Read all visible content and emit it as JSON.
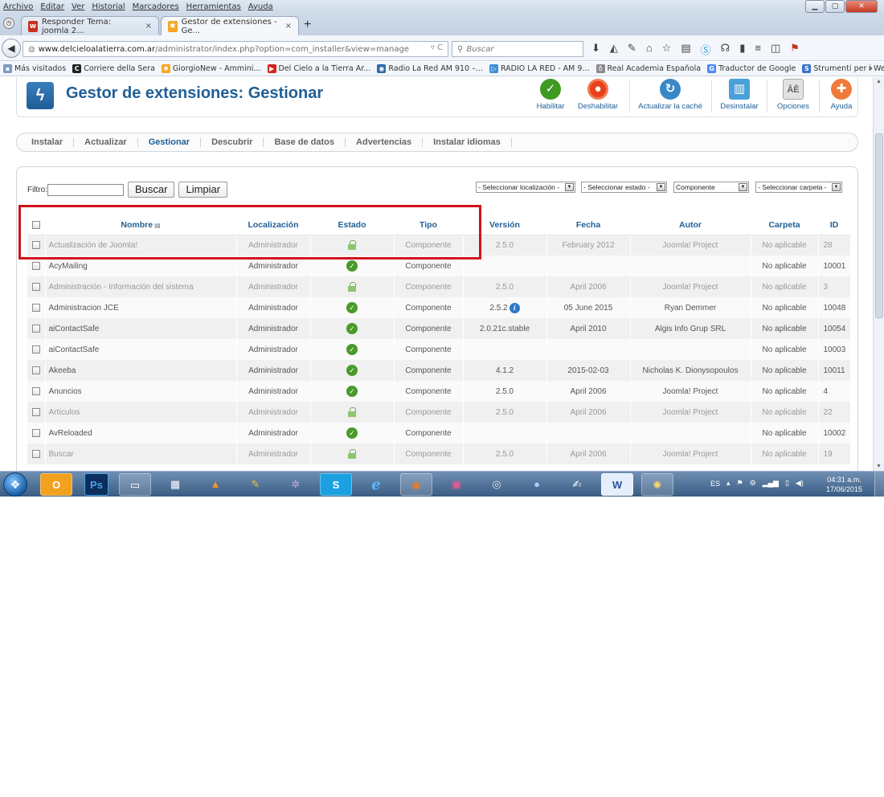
{
  "menubar": {
    "items": [
      "Archivo",
      "Editar",
      "Ver",
      "Historial",
      "Marcadores",
      "Herramientas",
      "Ayuda"
    ]
  },
  "tabs": [
    {
      "title": "Responder Tema: joomla 2...",
      "active": false
    },
    {
      "title": "Gestor de extensiones - Ge...",
      "active": true
    }
  ],
  "tab_new_label": "+",
  "navigation": {
    "url_domain": "www.delcieloalatierra.com.ar",
    "url_path": "/administrator/index.php?option=com_installer&view=manage",
    "search_placeholder": "Buscar"
  },
  "bookmarks": [
    "Más visitados",
    "Corriere della Sera",
    "GiorgioNew - Ammini...",
    "Del Cielo a la Tierra Ar...",
    "Radio La Red AM 910 –...",
    "RADIO LA RED - AM 9...",
    "Real Academia Española",
    "Traductor de Google",
    "Strumenti per i Webm..."
  ],
  "bookmarks_overflow": "»",
  "page": {
    "title": "Gestor de extensiones: Gestionar",
    "toolbar": {
      "enable": "Habilitar",
      "disable": "Deshabilitar",
      "refresh_cache": "Actualizar la caché",
      "uninstall": "Desinstalar",
      "options": "Opciones",
      "help": "Ayuda"
    },
    "subnav": [
      {
        "label": "Instalar",
        "active": false
      },
      {
        "label": "Actualizar",
        "active": false
      },
      {
        "label": "Gestionar",
        "active": true
      },
      {
        "label": "Descubrir",
        "active": false
      },
      {
        "label": "Base de datos",
        "active": false
      },
      {
        "label": "Advertencias",
        "active": false
      },
      {
        "label": "Instalar idiomas",
        "active": false
      }
    ],
    "filter": {
      "label": "Filtro:",
      "value": "",
      "search_button": "Buscar",
      "clear_button": "Limpiar",
      "location_select": "- Seleccionar localización -",
      "state_select": "- Seleccionar estado -",
      "type_select": "Componente",
      "folder_select": "- Seleccionar carpeta -"
    },
    "table": {
      "columns": [
        "Nombre",
        "Localización",
        "Estado",
        "Tipo",
        "Versión",
        "Fecha",
        "Autor",
        "Carpeta",
        "ID"
      ],
      "rows": [
        {
          "name": "Actualización de Joomla!",
          "location": "Administrador",
          "state": "locked",
          "type": "Componente",
          "version": "2.5.0",
          "date": "February 2012",
          "author": "Joomla! Project",
          "folder": "No aplicable",
          "id": "28",
          "disabled": true,
          "info": false
        },
        {
          "name": "AcyMailing",
          "location": "Administrador",
          "state": "enabled",
          "type": "Componente",
          "version": "",
          "date": "",
          "author": "",
          "folder": "No aplicable",
          "id": "10001",
          "disabled": false,
          "info": false
        },
        {
          "name": "Administración - Información del sistema",
          "location": "Administrador",
          "state": "locked",
          "type": "Componente",
          "version": "2.5.0",
          "date": "April 2006",
          "author": "Joomla! Project",
          "folder": "No aplicable",
          "id": "3",
          "disabled": true,
          "info": false
        },
        {
          "name": "Administracion JCE",
          "location": "Administrador",
          "state": "enabled",
          "type": "Componente",
          "version": "2.5.2",
          "date": "05 June 2015",
          "author": "Ryan Demmer",
          "folder": "No aplicable",
          "id": "10048",
          "disabled": false,
          "info": true
        },
        {
          "name": "aiContactSafe",
          "location": "Administrador",
          "state": "enabled",
          "type": "Componente",
          "version": "2.0.21c.stable",
          "date": "April 2010",
          "author": "Algis Info Grup SRL",
          "folder": "No aplicable",
          "id": "10054",
          "disabled": false,
          "info": false
        },
        {
          "name": "aiContactSafe",
          "location": "Administrador",
          "state": "enabled",
          "type": "Componente",
          "version": "",
          "date": "",
          "author": "",
          "folder": "No aplicable",
          "id": "10003",
          "disabled": false,
          "info": false
        },
        {
          "name": "Akeeba",
          "location": "Administrador",
          "state": "enabled",
          "type": "Componente",
          "version": "4.1.2",
          "date": "2015-02-03",
          "author": "Nicholas K. Dionysopoulos",
          "folder": "No aplicable",
          "id": "10011",
          "disabled": false,
          "info": false
        },
        {
          "name": "Anuncios",
          "location": "Administrador",
          "state": "enabled",
          "type": "Componente",
          "version": "2.5.0",
          "date": "April 2006",
          "author": "Joomla! Project",
          "folder": "No aplicable",
          "id": "4",
          "disabled": false,
          "info": false
        },
        {
          "name": "Artículos",
          "location": "Administrador",
          "state": "locked",
          "type": "Componente",
          "version": "2.5.0",
          "date": "April 2006",
          "author": "Joomla! Project",
          "folder": "No aplicable",
          "id": "22",
          "disabled": true,
          "info": false
        },
        {
          "name": "AvReloaded",
          "location": "Administrador",
          "state": "enabled",
          "type": "Componente",
          "version": "",
          "date": "",
          "author": "",
          "folder": "No aplicable",
          "id": "10002",
          "disabled": false,
          "info": false
        },
        {
          "name": "Buscar",
          "location": "Administrador",
          "state": "locked",
          "type": "Componente",
          "version": "2.5.0",
          "date": "April 2006",
          "author": "Joomla! Project",
          "folder": "No aplicable",
          "id": "19",
          "disabled": true,
          "info": false
        }
      ]
    }
  },
  "taskbar": {
    "language": "ES",
    "time": "04:31 a.m.",
    "date": "17/06/2015"
  },
  "colors": {
    "accent": "#1f5f96",
    "highlight_box": "#d1121b",
    "enabled_green": "#4a9a2a"
  }
}
